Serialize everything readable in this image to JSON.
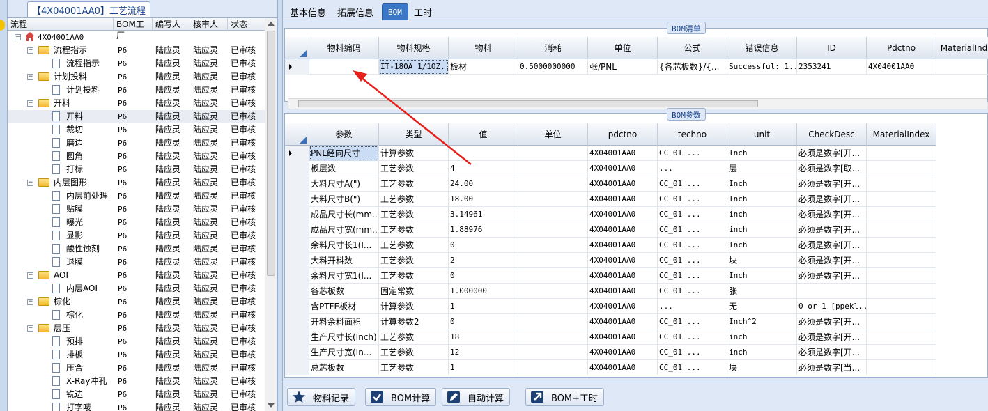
{
  "left": {
    "title": "【4X04001AA0】工艺流程",
    "columns": [
      "流程",
      "BOM工厂",
      "编写人",
      "核审人",
      "状态"
    ],
    "rows": [
      {
        "level": 0,
        "kind": "root",
        "label": "4X04001AA0",
        "factory": "",
        "writer": "",
        "checker": "",
        "status": ""
      },
      {
        "level": 1,
        "kind": "folder",
        "label": "流程指示",
        "factory": "P6",
        "writer": "陆应灵",
        "checker": "陆应灵",
        "status": "已审核"
      },
      {
        "level": 2,
        "kind": "doc",
        "label": "流程指示",
        "factory": "P6",
        "writer": "陆应灵",
        "checker": "陆应灵",
        "status": "已审核"
      },
      {
        "level": 1,
        "kind": "folder",
        "label": "计划投料",
        "factory": "P6",
        "writer": "陆应灵",
        "checker": "陆应灵",
        "status": "已审核"
      },
      {
        "level": 2,
        "kind": "doc",
        "label": "计划投料",
        "factory": "P6",
        "writer": "陆应灵",
        "checker": "陆应灵",
        "status": "已审核"
      },
      {
        "level": 1,
        "kind": "folder",
        "label": "开料",
        "factory": "P6",
        "writer": "陆应灵",
        "checker": "陆应灵",
        "status": "已审核"
      },
      {
        "level": 2,
        "kind": "doc",
        "label": "开料",
        "factory": "P6",
        "writer": "陆应灵",
        "checker": "陆应灵",
        "status": "已审核",
        "selected": true
      },
      {
        "level": 2,
        "kind": "doc",
        "label": "裁切",
        "factory": "P6",
        "writer": "陆应灵",
        "checker": "陆应灵",
        "status": "已审核"
      },
      {
        "level": 2,
        "kind": "doc",
        "label": "磨边",
        "factory": "P6",
        "writer": "陆应灵",
        "checker": "陆应灵",
        "status": "已审核"
      },
      {
        "level": 2,
        "kind": "doc",
        "label": "圆角",
        "factory": "P6",
        "writer": "陆应灵",
        "checker": "陆应灵",
        "status": "已审核"
      },
      {
        "level": 2,
        "kind": "doc",
        "label": "打标",
        "factory": "P6",
        "writer": "陆应灵",
        "checker": "陆应灵",
        "status": "已审核"
      },
      {
        "level": 1,
        "kind": "folder",
        "label": "内层图形",
        "factory": "P6",
        "writer": "陆应灵",
        "checker": "陆应灵",
        "status": "已审核"
      },
      {
        "level": 2,
        "kind": "doc",
        "label": "内层前处理",
        "factory": "P6",
        "writer": "陆应灵",
        "checker": "陆应灵",
        "status": "已审核"
      },
      {
        "level": 2,
        "kind": "doc",
        "label": "贴膜",
        "factory": "P6",
        "writer": "陆应灵",
        "checker": "陆应灵",
        "status": "已审核"
      },
      {
        "level": 2,
        "kind": "doc",
        "label": "曝光",
        "factory": "P6",
        "writer": "陆应灵",
        "checker": "陆应灵",
        "status": "已审核"
      },
      {
        "level": 2,
        "kind": "doc",
        "label": "显影",
        "factory": "P6",
        "writer": "陆应灵",
        "checker": "陆应灵",
        "status": "已审核"
      },
      {
        "level": 2,
        "kind": "doc",
        "label": "酸性蚀刻",
        "factory": "P6",
        "writer": "陆应灵",
        "checker": "陆应灵",
        "status": "已审核"
      },
      {
        "level": 2,
        "kind": "doc",
        "label": "退膜",
        "factory": "P6",
        "writer": "陆应灵",
        "checker": "陆应灵",
        "status": "已审核"
      },
      {
        "level": 1,
        "kind": "folder",
        "label": "AOI",
        "factory": "P6",
        "writer": "陆应灵",
        "checker": "陆应灵",
        "status": "已审核"
      },
      {
        "level": 2,
        "kind": "doc",
        "label": "内层AOI",
        "factory": "P6",
        "writer": "陆应灵",
        "checker": "陆应灵",
        "status": "已审核"
      },
      {
        "level": 1,
        "kind": "folder",
        "label": "棕化",
        "factory": "P6",
        "writer": "陆应灵",
        "checker": "陆应灵",
        "status": "已审核"
      },
      {
        "level": 2,
        "kind": "doc",
        "label": "棕化",
        "factory": "P6",
        "writer": "陆应灵",
        "checker": "陆应灵",
        "status": "已审核"
      },
      {
        "level": 1,
        "kind": "folder",
        "label": "层压",
        "factory": "P6",
        "writer": "陆应灵",
        "checker": "陆应灵",
        "status": "已审核"
      },
      {
        "level": 2,
        "kind": "doc",
        "label": "预排",
        "factory": "P6",
        "writer": "陆应灵",
        "checker": "陆应灵",
        "status": "已审核"
      },
      {
        "level": 2,
        "kind": "doc",
        "label": "排板",
        "factory": "P6",
        "writer": "陆应灵",
        "checker": "陆应灵",
        "status": "已审核"
      },
      {
        "level": 2,
        "kind": "doc",
        "label": "压合",
        "factory": "P6",
        "writer": "陆应灵",
        "checker": "陆应灵",
        "status": "已审核"
      },
      {
        "level": 2,
        "kind": "doc",
        "label": "X-Ray冲孔",
        "factory": "P6",
        "writer": "陆应灵",
        "checker": "陆应灵",
        "status": "已审核"
      },
      {
        "level": 2,
        "kind": "doc",
        "label": "铣边",
        "factory": "P6",
        "writer": "陆应灵",
        "checker": "陆应灵",
        "status": "已审核"
      },
      {
        "level": 2,
        "kind": "doc",
        "label": "打字唛",
        "factory": "P6",
        "writer": "陆应灵",
        "checker": "陆应灵",
        "status": "已审核"
      }
    ]
  },
  "tabs": [
    {
      "label": "基本信息",
      "active": false
    },
    {
      "label": "拓展信息",
      "active": false
    },
    {
      "label": "BOM",
      "active": true
    },
    {
      "label": "工时",
      "active": false
    }
  ],
  "bom_list": {
    "caption": "BOM清单",
    "columns": [
      "物料编码",
      "物料规格",
      "物料",
      "消耗",
      "单位",
      "公式",
      "错误信息",
      "ID",
      "Pdctno",
      "MaterialInd"
    ],
    "rows": [
      [
        "",
        "IT-180A 1/1OZ...",
        "板材",
        "0.5000000000",
        "张/PNL",
        "{各芯板数}/{...",
        "Successful: 1...",
        "2353241",
        "4X04001AA0",
        ""
      ]
    ]
  },
  "bom_params": {
    "caption": "BOM参数",
    "columns": [
      "参数",
      "类型",
      "值",
      "单位",
      "pdctno",
      "techno",
      "unit",
      "CheckDesc",
      "MaterialIndex"
    ],
    "rows": [
      [
        "PNL经向尺寸",
        "计算参数",
        "",
        "",
        "4X04001AA0",
        "CC_01 ...",
        "Inch",
        "必须是数字[开...",
        ""
      ],
      [
        "板层数",
        "工艺参数",
        "4",
        "",
        "4X04001AA0",
        "...",
        "层",
        "必须是数字[取...",
        ""
      ],
      [
        "大料尺寸A(\")",
        "工艺参数",
        "24.00",
        "",
        "4X04001AA0",
        "CC_01 ...",
        "Inch",
        "必须是数字[开...",
        ""
      ],
      [
        "大料尺寸B(\")",
        "工艺参数",
        "18.00",
        "",
        "4X04001AA0",
        "CC_01 ...",
        "Inch",
        "必须是数字[开...",
        ""
      ],
      [
        "成品尺寸长(mm...",
        "工艺参数",
        "3.14961",
        "",
        "4X04001AA0",
        "CC_01 ...",
        "inch",
        "必须是数字[开...",
        ""
      ],
      [
        "成品尺寸宽(mm...",
        "工艺参数",
        "1.88976",
        "",
        "4X04001AA0",
        "CC_01 ...",
        "inch",
        "必须是数字[开...",
        ""
      ],
      [
        "余料尺寸长1(I...",
        "工艺参数",
        "0",
        "",
        "4X04001AA0",
        "CC_01 ...",
        "Inch",
        "必须是数字[开...",
        ""
      ],
      [
        "大料开料数",
        "工艺参数",
        "2",
        "",
        "4X04001AA0",
        "CC_01 ...",
        "块",
        "必须是数字[开...",
        ""
      ],
      [
        "余料尺寸宽1(I...",
        "工艺参数",
        "0",
        "",
        "4X04001AA0",
        "CC_01 ...",
        "Inch",
        "必须是数字[开...",
        ""
      ],
      [
        "各芯板数",
        "固定常数",
        "1.000000",
        "",
        "4X04001AA0",
        "CC_01 ...",
        "张",
        "",
        ""
      ],
      [
        "含PTFE板材",
        "计算参数",
        "1",
        "",
        "4X04001AA0",
        "...",
        "无",
        "0 or 1 [ppekl...",
        ""
      ],
      [
        "开料余料面积",
        "计算参数2",
        "0",
        "",
        "4X04001AA0",
        "CC_01 ...",
        "Inch^2",
        "必须是数字[开...",
        ""
      ],
      [
        "生产尺寸长(Inch)",
        "工艺参数",
        "18",
        "",
        "4X04001AA0",
        "CC_01 ...",
        "inch",
        "必须是数字[开...",
        ""
      ],
      [
        "生产尺寸宽(In...",
        "工艺参数",
        "12",
        "",
        "4X04001AA0",
        "CC_01 ...",
        "inch",
        "必须是数字[开...",
        ""
      ],
      [
        "总芯板数",
        "工艺参数",
        "1",
        "",
        "4X04001AA0",
        "CC_01 ...",
        "块",
        "必须是数字[当...",
        ""
      ]
    ]
  },
  "buttons": [
    {
      "label": "物料记录",
      "icon": "star-icon"
    },
    {
      "label": "BOM计算",
      "icon": "checkbox-icon"
    },
    {
      "label": "自动计算",
      "icon": "pencil-icon"
    },
    {
      "label": "BOM+工时",
      "icon": "arrow-up-right-icon"
    }
  ],
  "colors": {
    "accent": "#3a78c7",
    "annotation_arrow": "#e8201c",
    "folder": "#f2b931"
  }
}
